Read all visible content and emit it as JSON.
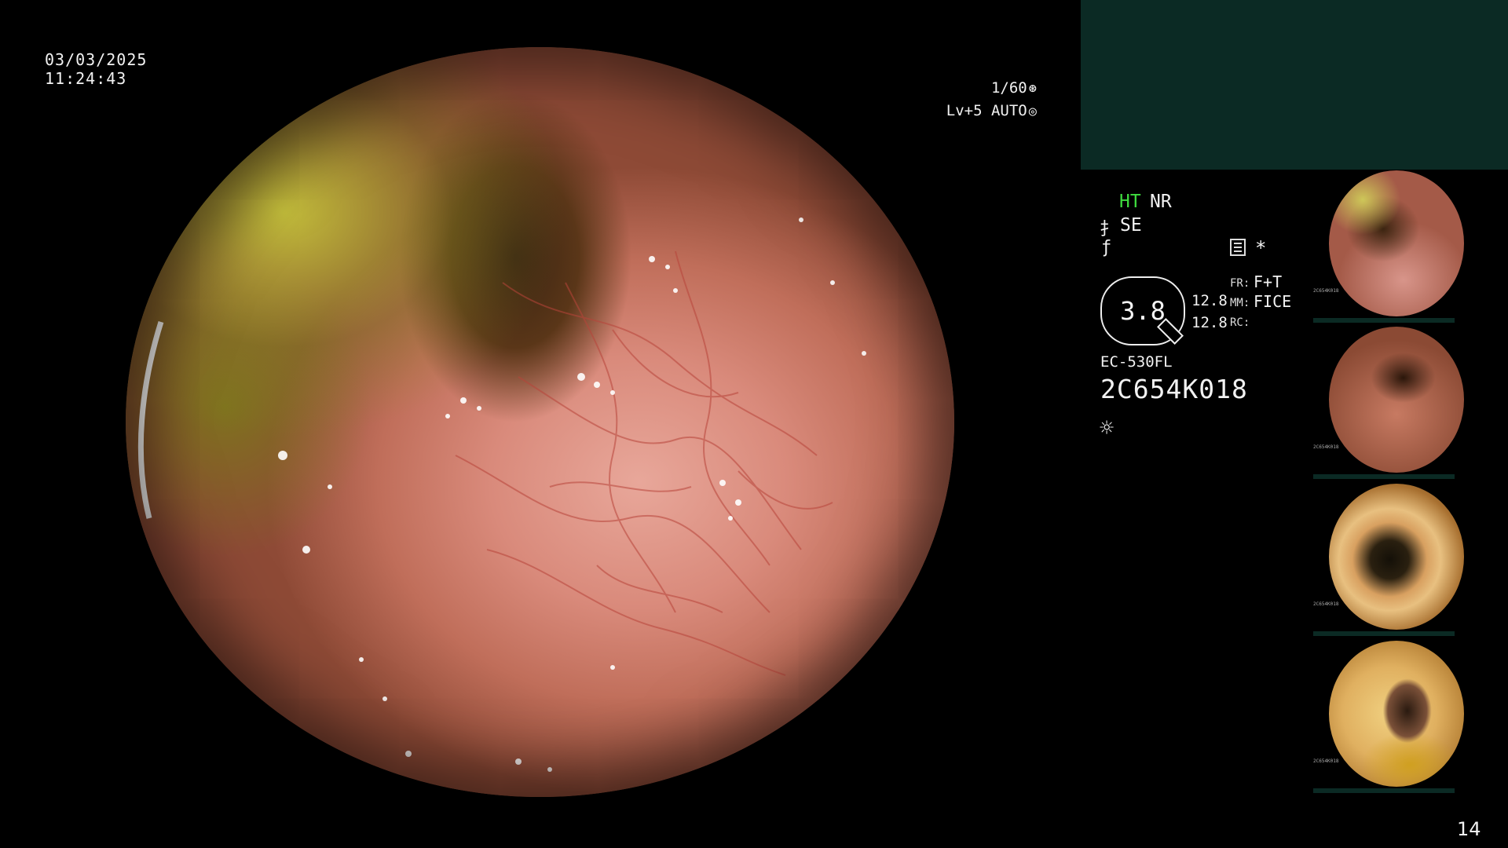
{
  "timestamp": {
    "date": "03/03/2025",
    "time": "11:24:43"
  },
  "shutter": {
    "speed": "1/60",
    "speed_icon": "⊛",
    "level": "Lv+5 AUTO",
    "level_icon": "◎"
  },
  "status": {
    "ht": "HT",
    "nr": "NR",
    "se_icon": "⺘",
    "se": "SE",
    "f_icon": "ƒ",
    "asterisk": "*",
    "zoom": "3.8",
    "val_a": "12.8",
    "val_b": "12.8",
    "fr_label": "FR:",
    "fr_value": "F+T",
    "mm_label": "MM:",
    "mm_value": "FICE",
    "rc_label": "RC:",
    "scope_model": "EC-530FL",
    "scope_serial": "2C654K018",
    "light_icon": "☼"
  },
  "thumbnails": [
    {
      "label": "2C654K018"
    },
    {
      "label": "2C654K018"
    },
    {
      "label": "2C654K018"
    },
    {
      "label": "2C654K018"
    }
  ],
  "page_number": "14",
  "colors": {
    "panel": "#0b2a24",
    "ht_green": "#3fdc3f",
    "background": "#000000"
  }
}
